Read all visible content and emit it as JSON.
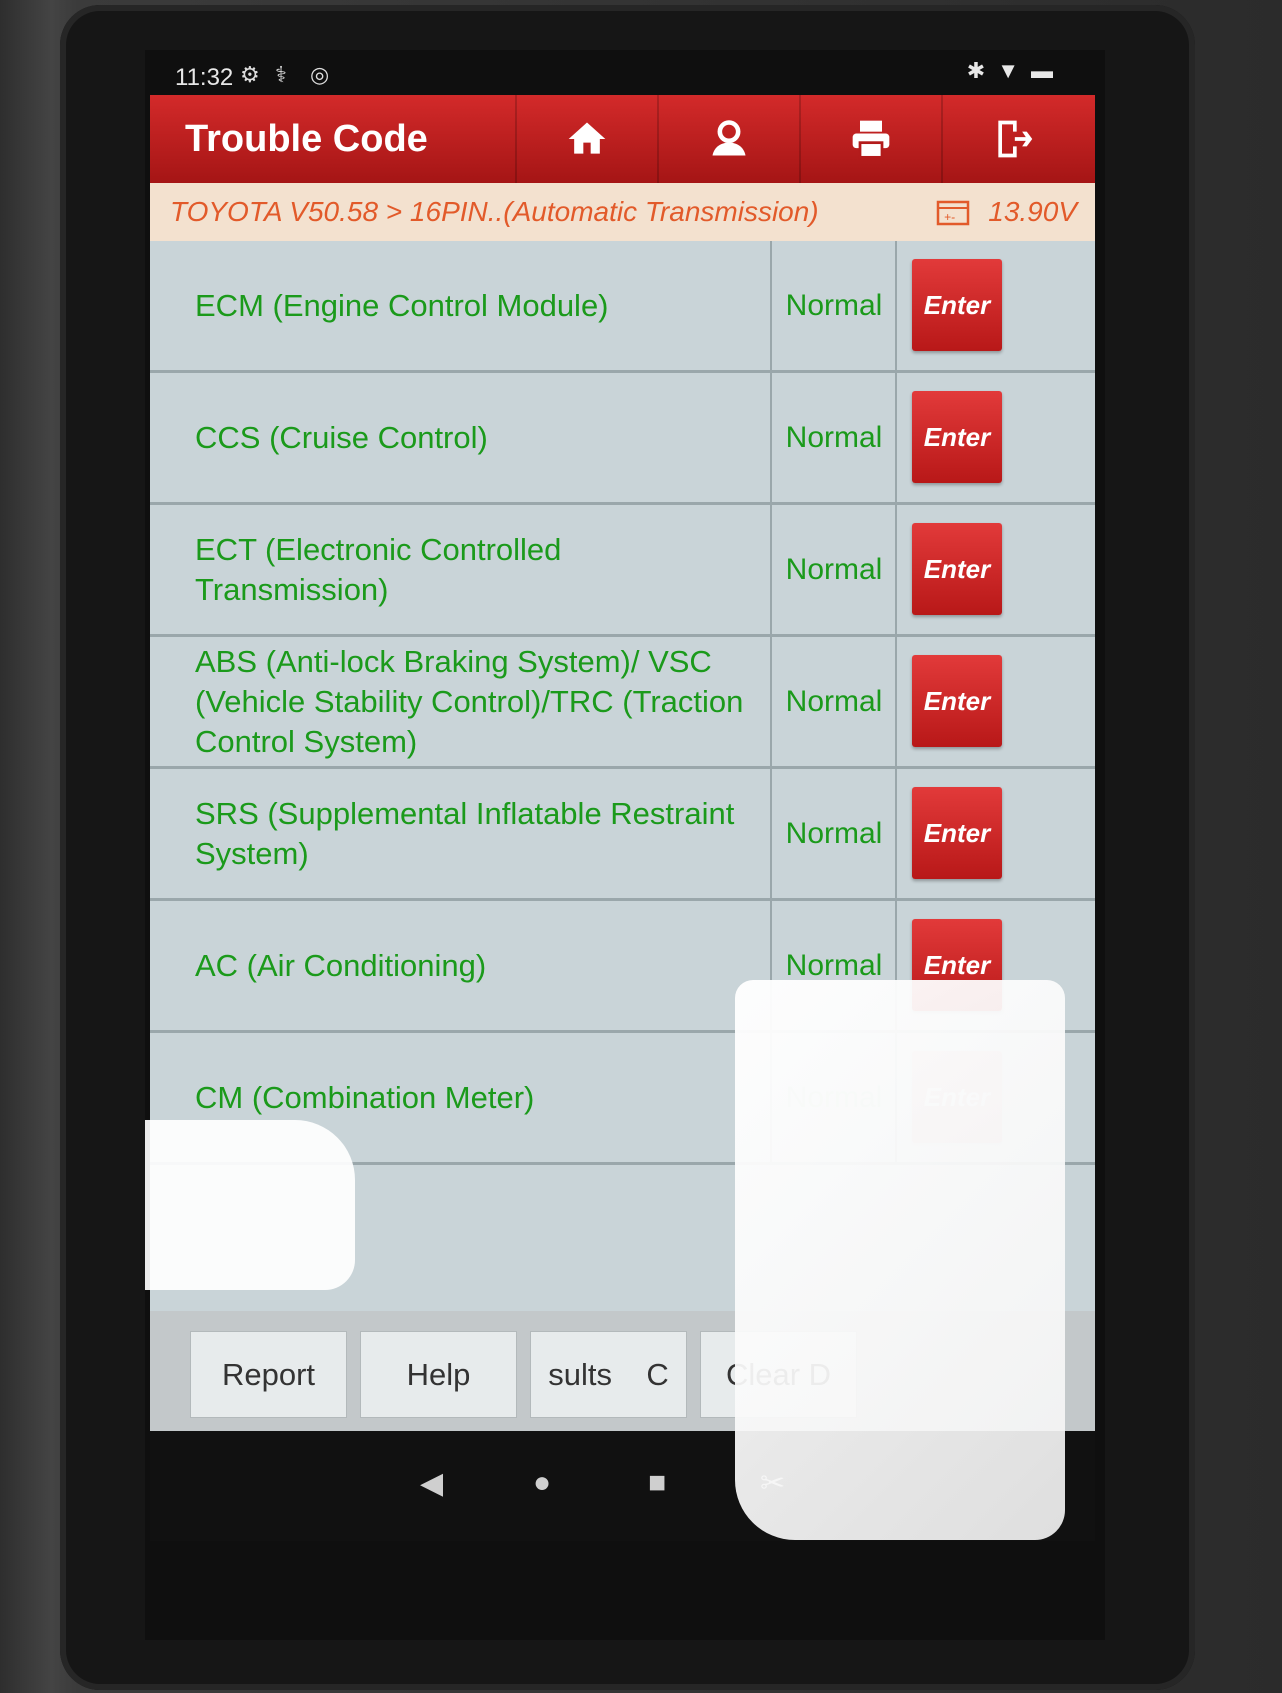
{
  "status_bar": {
    "time": "11:32"
  },
  "header": {
    "title": "Trouble Code",
    "buttons": [
      "home-icon",
      "user-icon",
      "print-icon",
      "exit-icon"
    ]
  },
  "breadcrumb": {
    "path": "TOYOTA V50.58 > 16PIN..(Automatic Transmission)",
    "voltage": "13.90V"
  },
  "systems": [
    {
      "name": "ECM (Engine Control Module)",
      "status": "Normal",
      "action": "Enter"
    },
    {
      "name": "CCS (Cruise Control)",
      "status": "Normal",
      "action": "Enter"
    },
    {
      "name": "ECT (Electronic Controlled Transmission)",
      "status": "Normal",
      "action": "Enter"
    },
    {
      "name": "ABS (Anti-lock Braking System)/ VSC (Vehicle Stability Control)/TRC (Traction Control System)",
      "status": "Normal",
      "action": "Enter"
    },
    {
      "name": "SRS (Supplemental Inflatable Restraint System)",
      "status": "Normal",
      "action": "Enter"
    },
    {
      "name": "AC (Air Conditioning)",
      "status": "Normal",
      "action": "Enter"
    },
    {
      "name": "CM (Combination Meter)",
      "status": "Normal",
      "action": "Enter"
    }
  ],
  "toolbar": {
    "report": "Report",
    "help": "Help",
    "results": "sults",
    "results_suffix": "C",
    "clear": "Clear D"
  },
  "colors": {
    "header_red": "#c42020",
    "status_green": "#1b9a1b",
    "crumb_orange": "#e25a2a"
  }
}
